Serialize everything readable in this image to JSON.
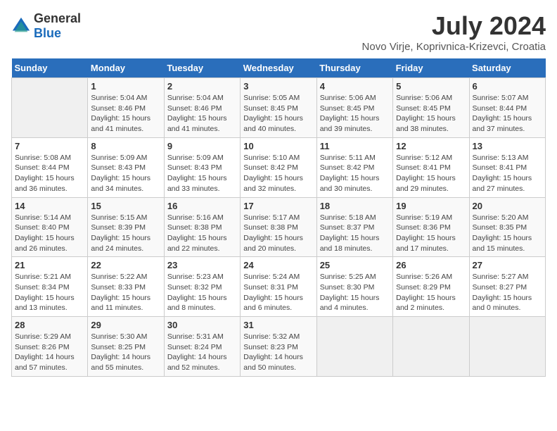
{
  "header": {
    "logo": {
      "general": "General",
      "blue": "Blue"
    },
    "title": "July 2024",
    "location": "Novo Virje, Koprivnica-Krizevci, Croatia"
  },
  "days_of_week": [
    "Sunday",
    "Monday",
    "Tuesday",
    "Wednesday",
    "Thursday",
    "Friday",
    "Saturday"
  ],
  "weeks": [
    [
      {
        "day": "",
        "info": ""
      },
      {
        "day": "1",
        "info": "Sunrise: 5:04 AM\nSunset: 8:46 PM\nDaylight: 15 hours\nand 41 minutes."
      },
      {
        "day": "2",
        "info": "Sunrise: 5:04 AM\nSunset: 8:46 PM\nDaylight: 15 hours\nand 41 minutes."
      },
      {
        "day": "3",
        "info": "Sunrise: 5:05 AM\nSunset: 8:45 PM\nDaylight: 15 hours\nand 40 minutes."
      },
      {
        "day": "4",
        "info": "Sunrise: 5:06 AM\nSunset: 8:45 PM\nDaylight: 15 hours\nand 39 minutes."
      },
      {
        "day": "5",
        "info": "Sunrise: 5:06 AM\nSunset: 8:45 PM\nDaylight: 15 hours\nand 38 minutes."
      },
      {
        "day": "6",
        "info": "Sunrise: 5:07 AM\nSunset: 8:44 PM\nDaylight: 15 hours\nand 37 minutes."
      }
    ],
    [
      {
        "day": "7",
        "info": "Sunrise: 5:08 AM\nSunset: 8:44 PM\nDaylight: 15 hours\nand 36 minutes."
      },
      {
        "day": "8",
        "info": "Sunrise: 5:09 AM\nSunset: 8:43 PM\nDaylight: 15 hours\nand 34 minutes."
      },
      {
        "day": "9",
        "info": "Sunrise: 5:09 AM\nSunset: 8:43 PM\nDaylight: 15 hours\nand 33 minutes."
      },
      {
        "day": "10",
        "info": "Sunrise: 5:10 AM\nSunset: 8:42 PM\nDaylight: 15 hours\nand 32 minutes."
      },
      {
        "day": "11",
        "info": "Sunrise: 5:11 AM\nSunset: 8:42 PM\nDaylight: 15 hours\nand 30 minutes."
      },
      {
        "day": "12",
        "info": "Sunrise: 5:12 AM\nSunset: 8:41 PM\nDaylight: 15 hours\nand 29 minutes."
      },
      {
        "day": "13",
        "info": "Sunrise: 5:13 AM\nSunset: 8:41 PM\nDaylight: 15 hours\nand 27 minutes."
      }
    ],
    [
      {
        "day": "14",
        "info": "Sunrise: 5:14 AM\nSunset: 8:40 PM\nDaylight: 15 hours\nand 26 minutes."
      },
      {
        "day": "15",
        "info": "Sunrise: 5:15 AM\nSunset: 8:39 PM\nDaylight: 15 hours\nand 24 minutes."
      },
      {
        "day": "16",
        "info": "Sunrise: 5:16 AM\nSunset: 8:38 PM\nDaylight: 15 hours\nand 22 minutes."
      },
      {
        "day": "17",
        "info": "Sunrise: 5:17 AM\nSunset: 8:38 PM\nDaylight: 15 hours\nand 20 minutes."
      },
      {
        "day": "18",
        "info": "Sunrise: 5:18 AM\nSunset: 8:37 PM\nDaylight: 15 hours\nand 18 minutes."
      },
      {
        "day": "19",
        "info": "Sunrise: 5:19 AM\nSunset: 8:36 PM\nDaylight: 15 hours\nand 17 minutes."
      },
      {
        "day": "20",
        "info": "Sunrise: 5:20 AM\nSunset: 8:35 PM\nDaylight: 15 hours\nand 15 minutes."
      }
    ],
    [
      {
        "day": "21",
        "info": "Sunrise: 5:21 AM\nSunset: 8:34 PM\nDaylight: 15 hours\nand 13 minutes."
      },
      {
        "day": "22",
        "info": "Sunrise: 5:22 AM\nSunset: 8:33 PM\nDaylight: 15 hours\nand 11 minutes."
      },
      {
        "day": "23",
        "info": "Sunrise: 5:23 AM\nSunset: 8:32 PM\nDaylight: 15 hours\nand 8 minutes."
      },
      {
        "day": "24",
        "info": "Sunrise: 5:24 AM\nSunset: 8:31 PM\nDaylight: 15 hours\nand 6 minutes."
      },
      {
        "day": "25",
        "info": "Sunrise: 5:25 AM\nSunset: 8:30 PM\nDaylight: 15 hours\nand 4 minutes."
      },
      {
        "day": "26",
        "info": "Sunrise: 5:26 AM\nSunset: 8:29 PM\nDaylight: 15 hours\nand 2 minutes."
      },
      {
        "day": "27",
        "info": "Sunrise: 5:27 AM\nSunset: 8:27 PM\nDaylight: 15 hours\nand 0 minutes."
      }
    ],
    [
      {
        "day": "28",
        "info": "Sunrise: 5:29 AM\nSunset: 8:26 PM\nDaylight: 14 hours\nand 57 minutes."
      },
      {
        "day": "29",
        "info": "Sunrise: 5:30 AM\nSunset: 8:25 PM\nDaylight: 14 hours\nand 55 minutes."
      },
      {
        "day": "30",
        "info": "Sunrise: 5:31 AM\nSunset: 8:24 PM\nDaylight: 14 hours\nand 52 minutes."
      },
      {
        "day": "31",
        "info": "Sunrise: 5:32 AM\nSunset: 8:23 PM\nDaylight: 14 hours\nand 50 minutes."
      },
      {
        "day": "",
        "info": ""
      },
      {
        "day": "",
        "info": ""
      },
      {
        "day": "",
        "info": ""
      }
    ]
  ]
}
